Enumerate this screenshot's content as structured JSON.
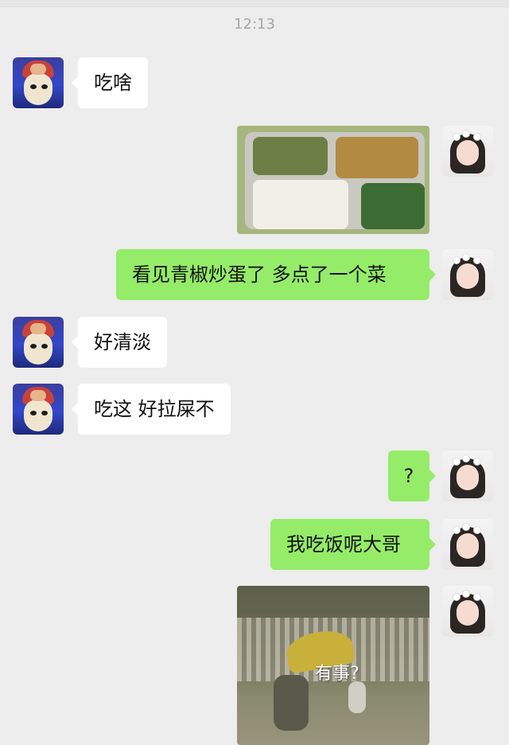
{
  "chat": {
    "time": "12:13",
    "messages": [
      {
        "side": "left",
        "type": "text",
        "text": "吃啥"
      },
      {
        "side": "right",
        "type": "image",
        "image": "food-photo"
      },
      {
        "side": "right",
        "type": "text",
        "text": "看见青椒炒蛋了 多点了一个菜"
      },
      {
        "side": "left",
        "type": "text",
        "text": "好清淡"
      },
      {
        "side": "left",
        "type": "text",
        "text": "吃这 好拉屎不"
      },
      {
        "side": "right",
        "type": "text",
        "text": "?"
      },
      {
        "side": "right",
        "type": "text",
        "text": "我吃饭呢大哥"
      },
      {
        "side": "right",
        "type": "image",
        "image": "street-photo",
        "caption": "有事?"
      }
    ]
  },
  "colors": {
    "background": "#ededed",
    "bubble_green": "#95ec69",
    "bubble_white": "#ffffff",
    "timestamp": "#a6a6a6"
  }
}
